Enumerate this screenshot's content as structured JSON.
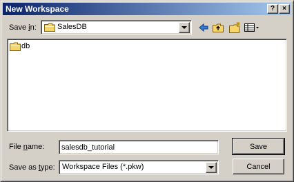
{
  "window": {
    "title": "New Workspace",
    "help_label": "?",
    "close_label": "×"
  },
  "save_in": {
    "label_prefix": "Save ",
    "label_accel": "i",
    "label_suffix": "n:",
    "value": "SalesDB"
  },
  "toolbar": {
    "icons": [
      "back-icon",
      "up-folder-icon",
      "new-folder-icon",
      "view-menu-icon"
    ]
  },
  "file_list": {
    "items": [
      {
        "name": "db",
        "icon": "folder-icon"
      }
    ]
  },
  "file_name": {
    "label_prefix": "File ",
    "label_accel": "n",
    "label_suffix": "ame:",
    "value": "salesdb_tutorial"
  },
  "save_as_type": {
    "label_prefix": "Save as ",
    "label_accel": "t",
    "label_suffix": "ype:",
    "value": "Workspace Files (*.pkw)"
  },
  "buttons": {
    "save": "Save",
    "cancel": "Cancel"
  },
  "colors": {
    "title_bar_start": "#0a246a",
    "title_bar_end": "#a6caf0",
    "dialog_face": "#d4d0c8",
    "folder_yellow": "#f6d56a"
  }
}
